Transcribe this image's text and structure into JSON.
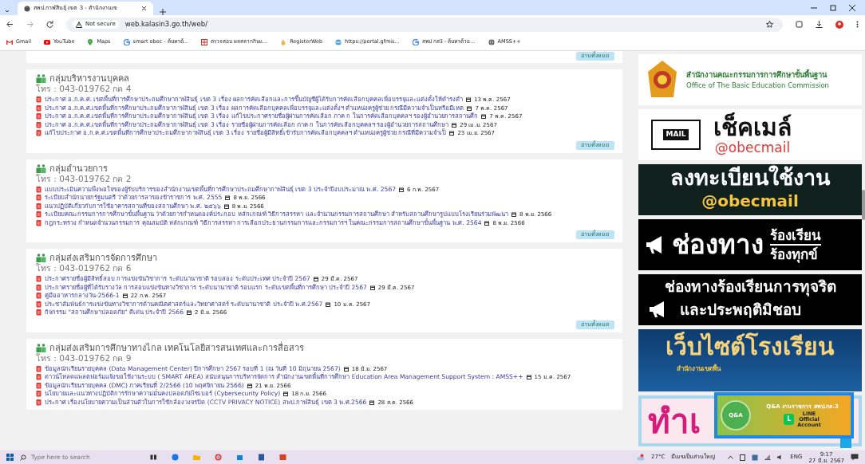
{
  "browser": {
    "tab_title": "สพป.กาฬสินธุ์ เขต 3 - สำนักงานเข",
    "address_warning": "Not secure",
    "url": "web.kalasin3.go.th/web/",
    "bookmarks": [
      {
        "kind": "gmail",
        "label": "Gmail"
      },
      {
        "kind": "youtube",
        "label": "YouTube"
      },
      {
        "kind": "maps",
        "label": "Maps"
      },
      {
        "kind": "google",
        "label": "smart obec - ค้นหาด้..."
      },
      {
        "kind": "grid",
        "label": "ตรวจสอบ ผลสลากกินแ..."
      },
      {
        "kind": "drop",
        "label": "RegisterWeb"
      },
      {
        "kind": "globe",
        "label": "https://portal.gfmis..."
      },
      {
        "kind": "google",
        "label": "สพป กส3 - ค้นหาด้วย..."
      },
      {
        "kind": "world",
        "label": "AMSS++"
      }
    ]
  },
  "top_button": "อ่านทั้งหมด",
  "sections": [
    {
      "title": "กลุ่มบริหารงานบุคคล",
      "phone": "โทร : 043-019762 กด 4",
      "button": "อ่านทั้งหมด",
      "items": [
        {
          "text": "ประกาศ อ.ก.ค.ศ. เขตพื้นที่การศึกษาประถมศึกษากาฬสินธุ์ เขต 3 เรื่อง ผลการคัดเลือกและการขึ้นบัญชีผู้ได้รับการคัดเลือกบุคคลเพื่อบรรจุและแต่งตั้งให้ดำรงตำ",
          "date": "13 พ.ค. 2567"
        },
        {
          "text": "ประกาศ อ.ก.ค.ศ.เขตพื้นที่การศึกษาประถมศึกษากาฬสินธุ์ เขต 3 เรื่อง ผลการคัดเลือกบุคคลเพื่อบรรจุและแต่งตั้งฯ ตำแหน่งครูผู้ช่วย กรณีมีความจำเป็นหรือมีเหต",
          "date": "7 พ.ค. 2567"
        },
        {
          "text": "ประกาศ อ.ก.ค.ศ.เขตพื้นที่การศึกษาประถมศึกษากาฬสินธุ์ เขต 3 เรื่อง แก้ไขประกาศรายชื่อผู้ผ่านการคัดเลือก ภาค ก ในการคัดเลือกบุคคลฯ รองผู้อำนวยการสถานศึก",
          "date": "7 พ.ค. 2567"
        },
        {
          "text": "ประกาศ อ.ก.ค.ศ.เขตพื้นที่การศึกษาประถมศึกษากาฬสินธุ์ เขต 3 เรื่อง รายชื่อผู้ผ่านการคัดเลือก ภาค ก ในการคัดเลือกบุคคลฯ รองผู้อำนวยการสถานศึกษา",
          "date": "29 เม.ย. 2567"
        },
        {
          "text": "แก้ไขประกาศ อ.ก.ค.ศ.เขตพื้นที่การศึกษาประถมศึกษากาฬสินธุ์ เขต 3 เรื่อง รายชื่อผู้มีสิทธิ์เข้ารับการคัดเลือกบุคคลฯ ตำแหน่งครูผู้ช่วย กรณีที่มีความจำเป็",
          "date": "23 เม.ย. 2567"
        }
      ]
    },
    {
      "title": "กลุ่มอำนวยการ",
      "phone": "โทร : 043-019762 กด 2",
      "button": "อ่านทั้งหมด",
      "items": [
        {
          "text": "แบบประเมินความพึงพอใจของผู้รับบริการของสำนักงานเขตพื้นที่การศึกษาประถมศึกษากาฬสินธุ์ เขต 3 ประจำปีงบประมาณ พ.ศ. 2567",
          "date": "6 ก.พ. 2567"
        },
        {
          "text": "ระเบียบสำนักนายกรัฐมนตรี ว่าด้วยการลาของข้าราชการ พ.ศ. 2555",
          "date": "8 พ.ย. 2566"
        },
        {
          "text": "แนวปฏิบัติเกี่ยวกับการใช้อาคารสถานที่ของสถานศึกษา พ.ศ. ๒๕๖๖",
          "date": "8 พ.ย. 2566"
        },
        {
          "text": "ระเบียบคณะกรรมการการศึกษาขั้นพื้นฐาน ว่าด้วยการกำหนดองค์ประกอบ หลักเกณฑ์ วิธีการสรรหา และจำนวนกรรมการสถานศึกษา สำหรับสถานศึกษารูปแบบโรงเรียนร่วมพัฒนา",
          "date": "8 พ.ย. 2566"
        },
        {
          "text": "กฎกระทรวง กำหนดจำนวนกรรมการ คุณสมบัติ หลักเกณฑ์ วิธีการสรรหา การเลือกประธานกรรมการและกรรมการฯ ในคณะกรรมการสถานศึกษาขั้นพื้นฐาน พ.ศ. 2564",
          "date": "8 พ.ย. 2566"
        }
      ]
    },
    {
      "title": "กลุ่มส่งเสริมการจัดการศึกษา",
      "phone": "โทร : 043-019762 กด 6",
      "button": "อ่านทั้งหมด",
      "items": [
        {
          "text": "ประกาศรายชื่อผู้มีสิทธิ์สอบ การแข่งขันวิชาการ ระดับนานาชาติ รอบสอง ระดับประเทศ ประจำปี 2567",
          "date": "29 มี.ค. 2567"
        },
        {
          "text": "ประกาศรายชื่อผู้ที่ได้รับรางวัล การสอบแข่งขันทางวิชาการ ระดับนานาชาติ รอบแรก ระดับเขตพื้นที่การศึกษา ประจำปี 2567",
          "date": "29 มี.ค. 2567"
        },
        {
          "text": "คู่มืออาหารกลางวัน-2566-1",
          "date": "22 ก.พ. 2567"
        },
        {
          "text": "ประชาสัมพันธ์การแข่งขันทางวิชาการด้านคณิตศาสตร์และวิทยาศาสตร์ ระดับนานาชาติ ประจำปี พ.ศ.2567",
          "date": "10 ม.ค. 2567"
        },
        {
          "text": "กิจกรรม \"สถานศึกษาปลอดภัย\" ดีเด่น ประจำปี 2566",
          "date": "2 มิ.ย. 2566"
        }
      ]
    },
    {
      "title": "กลุ่มส่งเสริมการศึกษาทางไกล เทคโนโลยีสารสนเทศและการสื่อสาร",
      "phone": "โทร : 043-019762 กด 9",
      "items": [
        {
          "text": "ข้อมูลนักเรียนรายบุคคล (Data Management Center) ปีการศึกษา 2567 รอบที่ 1 (ณ วันที่ 10 มิถุนายน 2567)",
          "date": "18 มิ.ย. 2567"
        },
        {
          "text": "ดาวน์โหลดแพลตฟอร์มแจ้งขอใช้งานระบบ ( SMART AREA) สนับสนุนการบริหารจัดการ สำนักงานเขตพื้นที่การศึกษา Education Area Management Support System : AMSS++",
          "date": "15 ม.ค. 2567"
        },
        {
          "text": "ข้อมูลนักเรียนรายบุคคล (DMC) ภาคเรียนที่ 2/2566 (10 พฤศจิกายน 2566)",
          "date": "21 พ.ย. 2566"
        },
        {
          "text": "นโยบายและแนวทางปฏิบัติการรักษาความมั่นคงปลอดภัยไซเบอร์ (Cybersecurity Policy)",
          "date": "18 ก.ย. 2566"
        },
        {
          "text": "ประกาศ เรื่องนโยบายความเป็นส่วนตัวในการใช้กล้องวงจรปิด (CCTV PRIVACY NOTICE) สพป.กาฬสินธุ์ เขต 3 พ.ศ.2566",
          "date": "28 ส.ค. 2566"
        }
      ]
    }
  ],
  "banners": [
    {
      "kind": "obec",
      "lines": [
        "สำนักงานคณะกรรมการการศึกษาขั้นพื้นฐาน",
        "Office of The Basic Education Commission"
      ]
    },
    {
      "kind": "checkmail",
      "tag": "MAIL",
      "lines": [
        "เช็คเมล์",
        "@obecmail"
      ]
    },
    {
      "kind": "register",
      "lines": [
        "ลงทะเบียนใช้งาน",
        "@obecmail"
      ]
    },
    {
      "kind": "complaint",
      "lines": [
        "ช่องทาง",
        "ร้องเรียน",
        "ร้องทุกข์"
      ]
    },
    {
      "kind": "corruption",
      "lines": [
        "ช่องทางร้องเรียนการทุจริต",
        "และประพฤติมิชอบ"
      ]
    },
    {
      "kind": "schools",
      "lines": [
        "เว็บไซต์โรงเรียน",
        "สำนักงานเขตพื้น"
      ]
    },
    {
      "kind": "partial",
      "lines": [
        "ทำเ"
      ]
    }
  ],
  "line_popup": {
    "logo_text": "Q&A",
    "title": "Q&A งานราชการ สพป.กส.3",
    "badge": "L",
    "badge_lines": [
      "LINE",
      "Official",
      "Account"
    ]
  },
  "taskbar": {
    "search_placeholder": "Type here to search",
    "temperature": "27°C",
    "weather_text": "มีเมฆเป็นส่วนใหญ่",
    "language": "ENG",
    "time": "9:17",
    "date": "27 มิ.ย. 2567"
  }
}
